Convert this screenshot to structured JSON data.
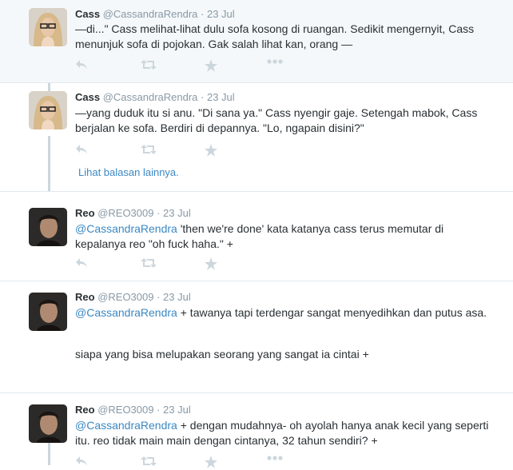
{
  "tweets": [
    {
      "name": "Cass",
      "handle": "@CassandraRendra",
      "time": "23 Jul",
      "text": "—di...\" Cass melihat-lihat dulu sofa kosong di ruangan. Sedikit mengernyit, Cass menunjuk sofa di pojokan. Gak salah lihat kan, orang —"
    },
    {
      "name": "Cass",
      "handle": "@CassandraRendra",
      "time": "23 Jul",
      "text": "—yang duduk itu si anu. \"Di sana ya.\" Cass nyengir gaje. Setengah mabok, Cass berjalan ke sofa. Berdiri di depannya. \"Lo, ngapain disini?\""
    },
    {
      "name": "Reo",
      "handle": "@REO3009",
      "time": "23 Jul",
      "mention": "@CassandraRendra",
      "text": " 'then we're done' kata katanya cass terus memutar di kepalanya reo \"oh fuck haha.\" +"
    },
    {
      "name": "Reo",
      "handle": "@REO3009",
      "time": "23 Jul",
      "mention": "@CassandraRendra",
      "text": " + tawanya tapi terdengar sangat menyedihkan dan putus asa.",
      "text2": "siapa yang bisa melupakan seorang yang sangat ia cintai +"
    },
    {
      "name": "Reo",
      "handle": "@REO3009",
      "time": "23 Jul",
      "mention": "@CassandraRendra",
      "text": " + dengan mudahnya- oh ayolah hanya anak kecil yang seperti itu. reo tidak main main dengan cintanya, 32 tahun sendiri? +"
    }
  ],
  "more_replies": "Lihat balasan lainnya.",
  "separator": " · ",
  "icons": [
    "reply-icon",
    "retweet-icon",
    "favorite-icon",
    "more-icon"
  ],
  "colors": {
    "link": "#3b88c3",
    "muted": "#8899a6",
    "highlight_bg": "#f5f8fa",
    "thread": "#ccd6dd"
  }
}
